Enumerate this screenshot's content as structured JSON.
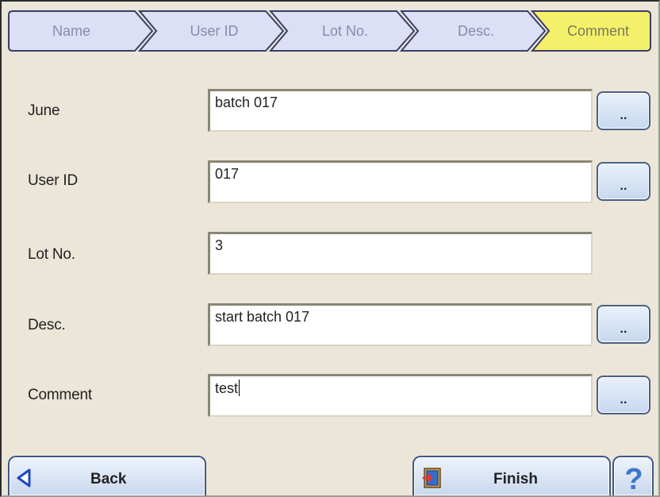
{
  "wizard": {
    "steps": [
      {
        "label": "Name",
        "active": false
      },
      {
        "label": "User ID",
        "active": false
      },
      {
        "label": "Lot No.",
        "active": false
      },
      {
        "label": "Desc.",
        "active": false
      },
      {
        "label": "Comment",
        "active": true
      }
    ]
  },
  "form": {
    "fields": [
      {
        "label": "June",
        "value": "batch 017",
        "has_picker": true,
        "picker_label": ".."
      },
      {
        "label": "User ID",
        "value": "017",
        "has_picker": true,
        "picker_label": ".."
      },
      {
        "label": "Lot No.",
        "value": "3",
        "has_picker": false
      },
      {
        "label": "Desc.",
        "value": "start batch 017",
        "has_picker": true,
        "picker_label": ".."
      },
      {
        "label": "Comment",
        "value": "test",
        "has_picker": true,
        "picker_label": ".."
      }
    ]
  },
  "footer": {
    "back_label": "Back",
    "finish_label": "Finish",
    "help_label": "?"
  },
  "colors": {
    "background": "#ebe6d8",
    "step_inactive": "#dcdff5",
    "step_active": "#f4f06a",
    "button_border": "#3f5887",
    "back_arrow": "#1f47c4",
    "help_blue": "#3a78c8"
  },
  "icons": {
    "back": "left-triangle-icon",
    "finish": "exit-door-icon",
    "help": "question-mark-icon",
    "picker": "ellipsis-icon"
  }
}
